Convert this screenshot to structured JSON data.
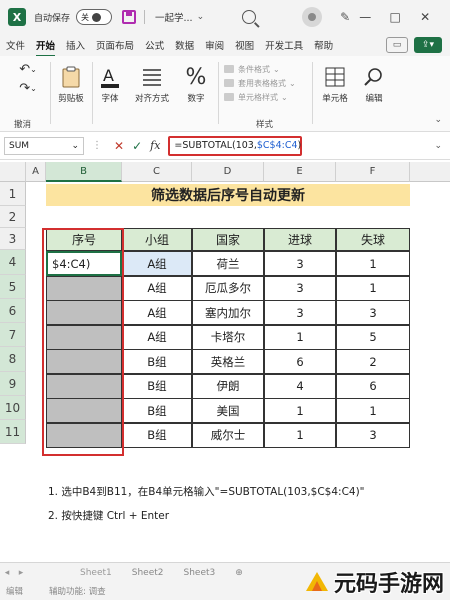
{
  "titlebar": {
    "autosave_label": "自动保存",
    "autosave_state": "关",
    "doc_title": "一起学...",
    "window_buttons": [
      "—",
      "□",
      "✕"
    ]
  },
  "menu": {
    "tabs": [
      "文件",
      "开始",
      "插入",
      "页面布局",
      "公式",
      "数据",
      "审阅",
      "视图",
      "开发工具",
      "帮助"
    ],
    "active_tab": "开始"
  },
  "ribbon": {
    "clipboard_label": "剪贴板",
    "font_label": "字体",
    "align_label": "对齐方式",
    "number_label": "数字",
    "cond_format": "条件格式",
    "table_format": "套用表格格式",
    "cell_style": "单元格样式",
    "styles_label": "样式",
    "cells_label": "单元格",
    "edit_label": "编辑",
    "undo_label": "撤消"
  },
  "formula_bar": {
    "name_box": "SUM",
    "formula_prefix": "=SUBTOTAL(103,",
    "formula_ref": "$C$4:C4",
    "formula_suffix": ")"
  },
  "grid": {
    "columns": [
      "A",
      "B",
      "C",
      "D",
      "E",
      "F"
    ],
    "rows": [
      "1",
      "2",
      "3",
      "4",
      "5",
      "6",
      "7",
      "8",
      "9",
      "10",
      "11"
    ],
    "title": "筛选数据后序号自动更新",
    "headers": [
      "序号",
      "小组",
      "国家",
      "进球",
      "失球"
    ],
    "active_cell_text": "$4:C4)",
    "data": [
      [
        "A组",
        "荷兰",
        "3",
        "1"
      ],
      [
        "A组",
        "厄瓜多尔",
        "3",
        "1"
      ],
      [
        "A组",
        "塞内加尔",
        "3",
        "3"
      ],
      [
        "A组",
        "卡塔尔",
        "1",
        "5"
      ],
      [
        "B组",
        "英格兰",
        "6",
        "2"
      ],
      [
        "B组",
        "伊朗",
        "4",
        "6"
      ],
      [
        "B组",
        "美国",
        "1",
        "1"
      ],
      [
        "B组",
        "威尔士",
        "1",
        "3"
      ]
    ]
  },
  "instructions": [
    "1. 选中B4到B11，在B4单元格输入\"=SUBTOTAL(103,$C$4:C4)\"",
    "2. 按快捷键 Ctrl + Enter"
  ],
  "sheets": [
    "Sheet1",
    "Sheet2",
    "Sheet3"
  ],
  "status": {
    "mode": "编辑",
    "accessibility": "辅助功能: 调查"
  },
  "watermark": "元码手游网",
  "colors": {
    "excel_green": "#1e7145",
    "title_fill": "#fce4a0",
    "header_fill": "#d9ebd3",
    "highlight_red": "#d32f2f",
    "selected_gray": "#bfbfbf"
  }
}
